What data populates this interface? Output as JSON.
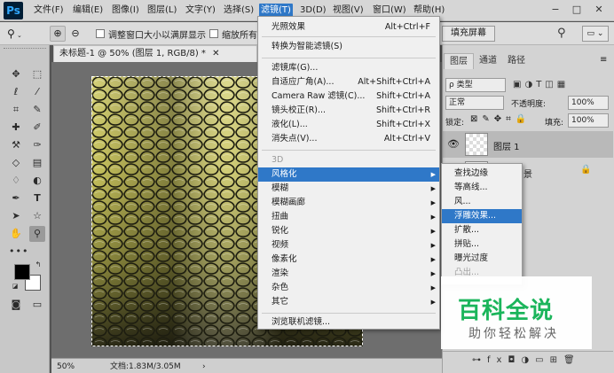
{
  "menubar": {
    "logo": "Ps",
    "items": [
      "文件(F)",
      "编辑(E)",
      "图像(I)",
      "图层(L)",
      "文字(Y)",
      "选择(S)",
      "滤镜(T)",
      "3D(D)",
      "视图(V)",
      "窗口(W)",
      "帮助(H)"
    ],
    "window_buttons": [
      "−",
      "□",
      "✕"
    ]
  },
  "options_bar": {
    "zoom_tool": "🔍",
    "resize_checkbox_label": "调整窗口大小以满屏显示",
    "scrub_checkbox_label": "缩放所有窗",
    "fill_screen_button": "填充屏幕"
  },
  "document": {
    "tab_title": "未标题-1 @ 50% (图层 1, RGB/8) *",
    "close": "✕",
    "zoom": "50%",
    "doc_info": "文档:1.83M/3.05M"
  },
  "filter_menu": {
    "items": [
      {
        "label": "光照效果",
        "shortcut": "Alt+Ctrl+F"
      },
      {
        "label": "转换为智能滤镜(S)",
        "shortcut": ""
      },
      {
        "label": "滤镜库(G)...",
        "shortcut": ""
      },
      {
        "label": "自适应广角(A)...",
        "shortcut": "Alt+Shift+Ctrl+A"
      },
      {
        "label": "Camera Raw 滤镜(C)...",
        "shortcut": "Shift+Ctrl+A"
      },
      {
        "label": "镜头校正(R)...",
        "shortcut": "Shift+Ctrl+R"
      },
      {
        "label": "液化(L)...",
        "shortcut": "Shift+Ctrl+X"
      },
      {
        "label": "消失点(V)...",
        "shortcut": "Alt+Ctrl+V"
      },
      {
        "label": "3D",
        "shortcut": ""
      },
      {
        "label": "风格化",
        "shortcut": ""
      },
      {
        "label": "模糊",
        "shortcut": ""
      },
      {
        "label": "模糊画廊",
        "shortcut": ""
      },
      {
        "label": "扭曲",
        "shortcut": ""
      },
      {
        "label": "锐化",
        "shortcut": ""
      },
      {
        "label": "视频",
        "shortcut": ""
      },
      {
        "label": "像素化",
        "shortcut": ""
      },
      {
        "label": "渲染",
        "shortcut": ""
      },
      {
        "label": "杂色",
        "shortcut": ""
      },
      {
        "label": "其它",
        "shortcut": ""
      },
      {
        "label": "浏览联机滤镜...",
        "shortcut": ""
      }
    ]
  },
  "stylize_submenu": {
    "items": [
      "查找边缘",
      "等高线...",
      "风...",
      "浮雕效果...",
      "扩散...",
      "拼贴...",
      "曝光过度",
      "凸出..."
    ]
  },
  "layers_panel": {
    "tabs": [
      "图层",
      "通道",
      "路径"
    ],
    "kind_filter": "ρ 类型",
    "blend_mode": "正常",
    "opacity_label": "不透明度:",
    "opacity_value": "100%",
    "lock_label": "锁定:",
    "fill_label": "填充:",
    "fill_value": "100%",
    "layer1_name": "图层 1",
    "layer2_suffix": "景"
  },
  "watermark": {
    "title": "百科全说",
    "subtitle": "助你轻松解决"
  }
}
